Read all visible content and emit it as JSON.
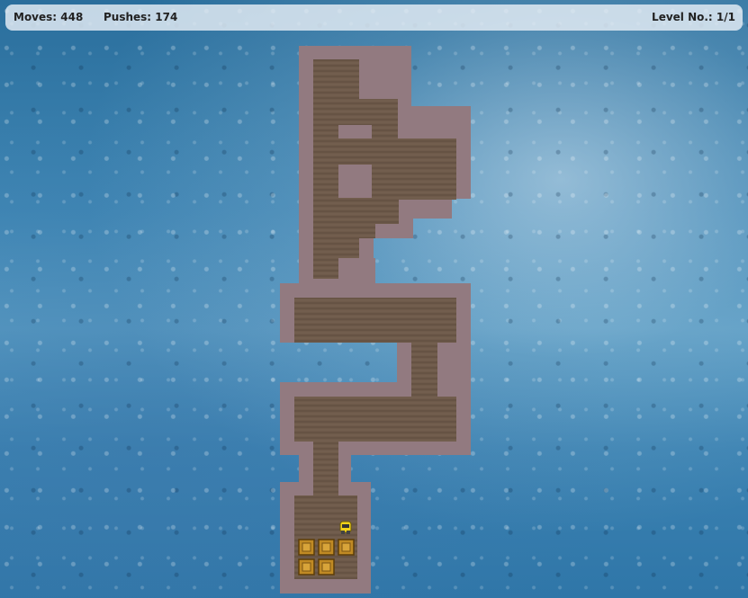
{
  "hud": {
    "moves_label": "Moves: 448",
    "pushes_label": "Pushes: 174",
    "level_label": "Level No.: 1/1"
  },
  "icons": {
    "player": "player-robot-icon",
    "box": "wooden-crate-icon"
  },
  "colors": {
    "wall": "#927a80",
    "floor": "#6e5a4a",
    "floor_dark": "#5c4a3c",
    "box": "#c08a24",
    "player": "#f2d21a"
  }
}
